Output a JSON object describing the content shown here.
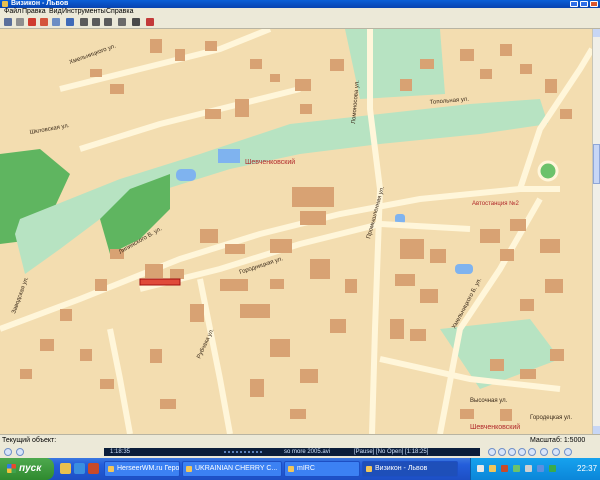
{
  "window": {
    "title": "Визикон - Львов"
  },
  "menu": {
    "items": [
      "Файл",
      "Правка",
      "Вид",
      "Инструменты",
      "Справка"
    ]
  },
  "toolbar": {
    "buttons": [
      "pointer",
      "pan",
      "select",
      "measure",
      "zoom-in",
      "zoom-out",
      "search",
      "info",
      "print",
      "layers"
    ]
  },
  "map": {
    "colors": {
      "land": "#f3ddb0",
      "road": "#fff6da",
      "park": "#b7e3c2",
      "building": "#d8a273",
      "water": "#7fb3ef",
      "forest": "#5fb560"
    },
    "streets": [
      "Хмельницкого ул.",
      "Топольная ул.",
      "Липинского В. ул.",
      "Городницкая ул.",
      "Промышленная ул.",
      "Заводская ул.",
      "Хмельницкого Б. ул.",
      "Шкловская ул.",
      "Ломоносова ул.",
      "Рубчака ул.",
      "Шевченковский",
      "Автостанция №2",
      "Высочная ул.",
      "Городецкая ул.",
      "Шевченковский"
    ],
    "area_label": "Шевченковский",
    "district_label": "Шевченковский"
  },
  "status": {
    "left": "Текущий объект:",
    "scale": "Масштаб: 1:5000"
  },
  "player": {
    "text": "so more 2005.avi",
    "status": "[Pause] [No Open] [1:18:25]",
    "time": "1:18:35"
  },
  "taskbar": {
    "start": "пуск",
    "tasks": [
      "HerseerWM.ru Герои...",
      "UKRAINIAN CHERRY C...",
      "mIRC",
      "Визикон - Львов"
    ],
    "clock": "22:37"
  }
}
